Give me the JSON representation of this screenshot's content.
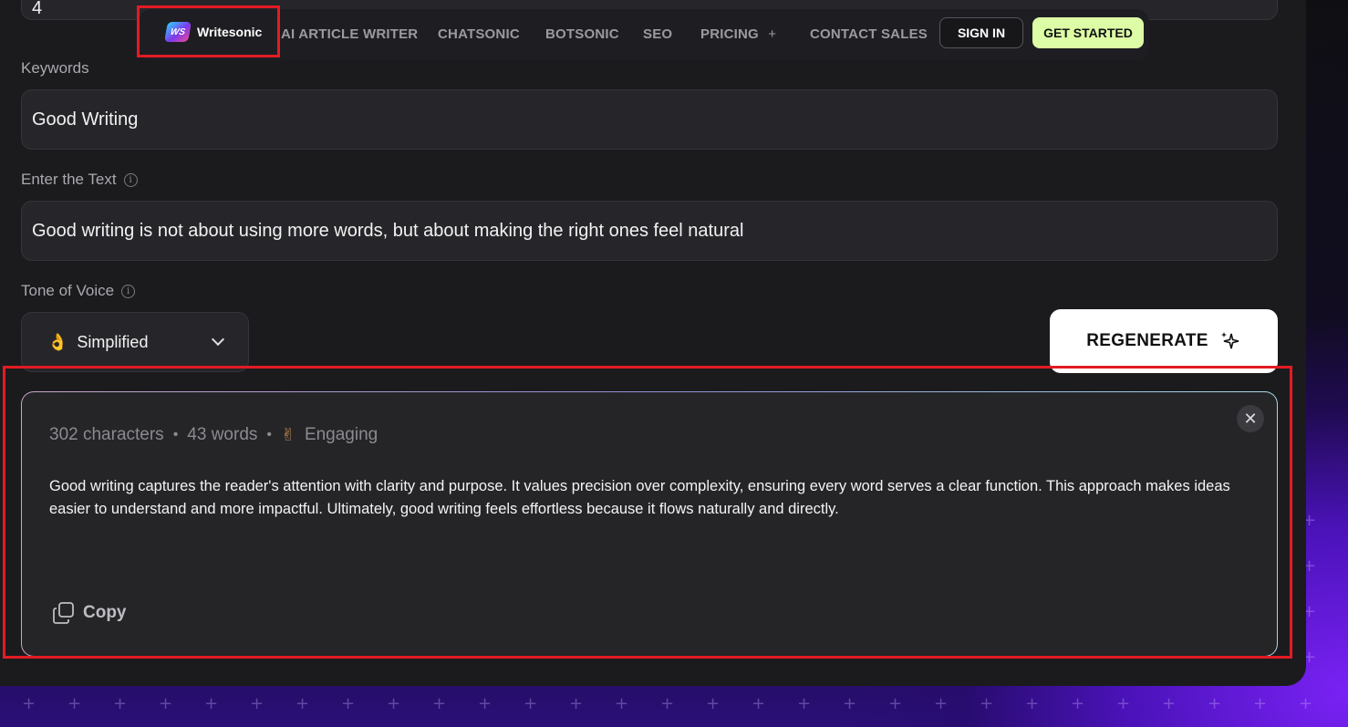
{
  "navbar": {
    "brand": "Writesonic",
    "logo_text": "WS",
    "links": [
      "AI ARTICLE WRITER",
      "CHATSONIC",
      "BOTSONIC",
      "SEO",
      "PRICING",
      "CONTACT SALES"
    ],
    "sign_in": "SIGN IN",
    "get_started": "GET STARTED"
  },
  "form": {
    "top_value": "4",
    "keywords_label": "Keywords",
    "keywords_value": "Good Writing",
    "text_label": "Enter the Text",
    "text_value": "Good writing is not about using more words, but about making the right ones feel natural",
    "tone_label": "Tone of Voice",
    "tone_value": "Simplified",
    "tone_emoji": "👌",
    "regenerate_label": "REGENERATE"
  },
  "output": {
    "characters": "302 characters",
    "words": "43 words",
    "tone_emoji": "✌",
    "tone": "Engaging",
    "text": "Good writing captures the reader's attention with clarity and purpose. It values precision over complexity, ensuring every word serves a clear function. This approach makes ideas easier to understand and more impactful. Ultimately, good writing feels effortless because it flows naturally and directly.",
    "copy_label": "Copy"
  },
  "colors": {
    "accent_green": "#dcfca5",
    "highlight_red": "#e31b23",
    "panel": "#1b1b1e"
  }
}
